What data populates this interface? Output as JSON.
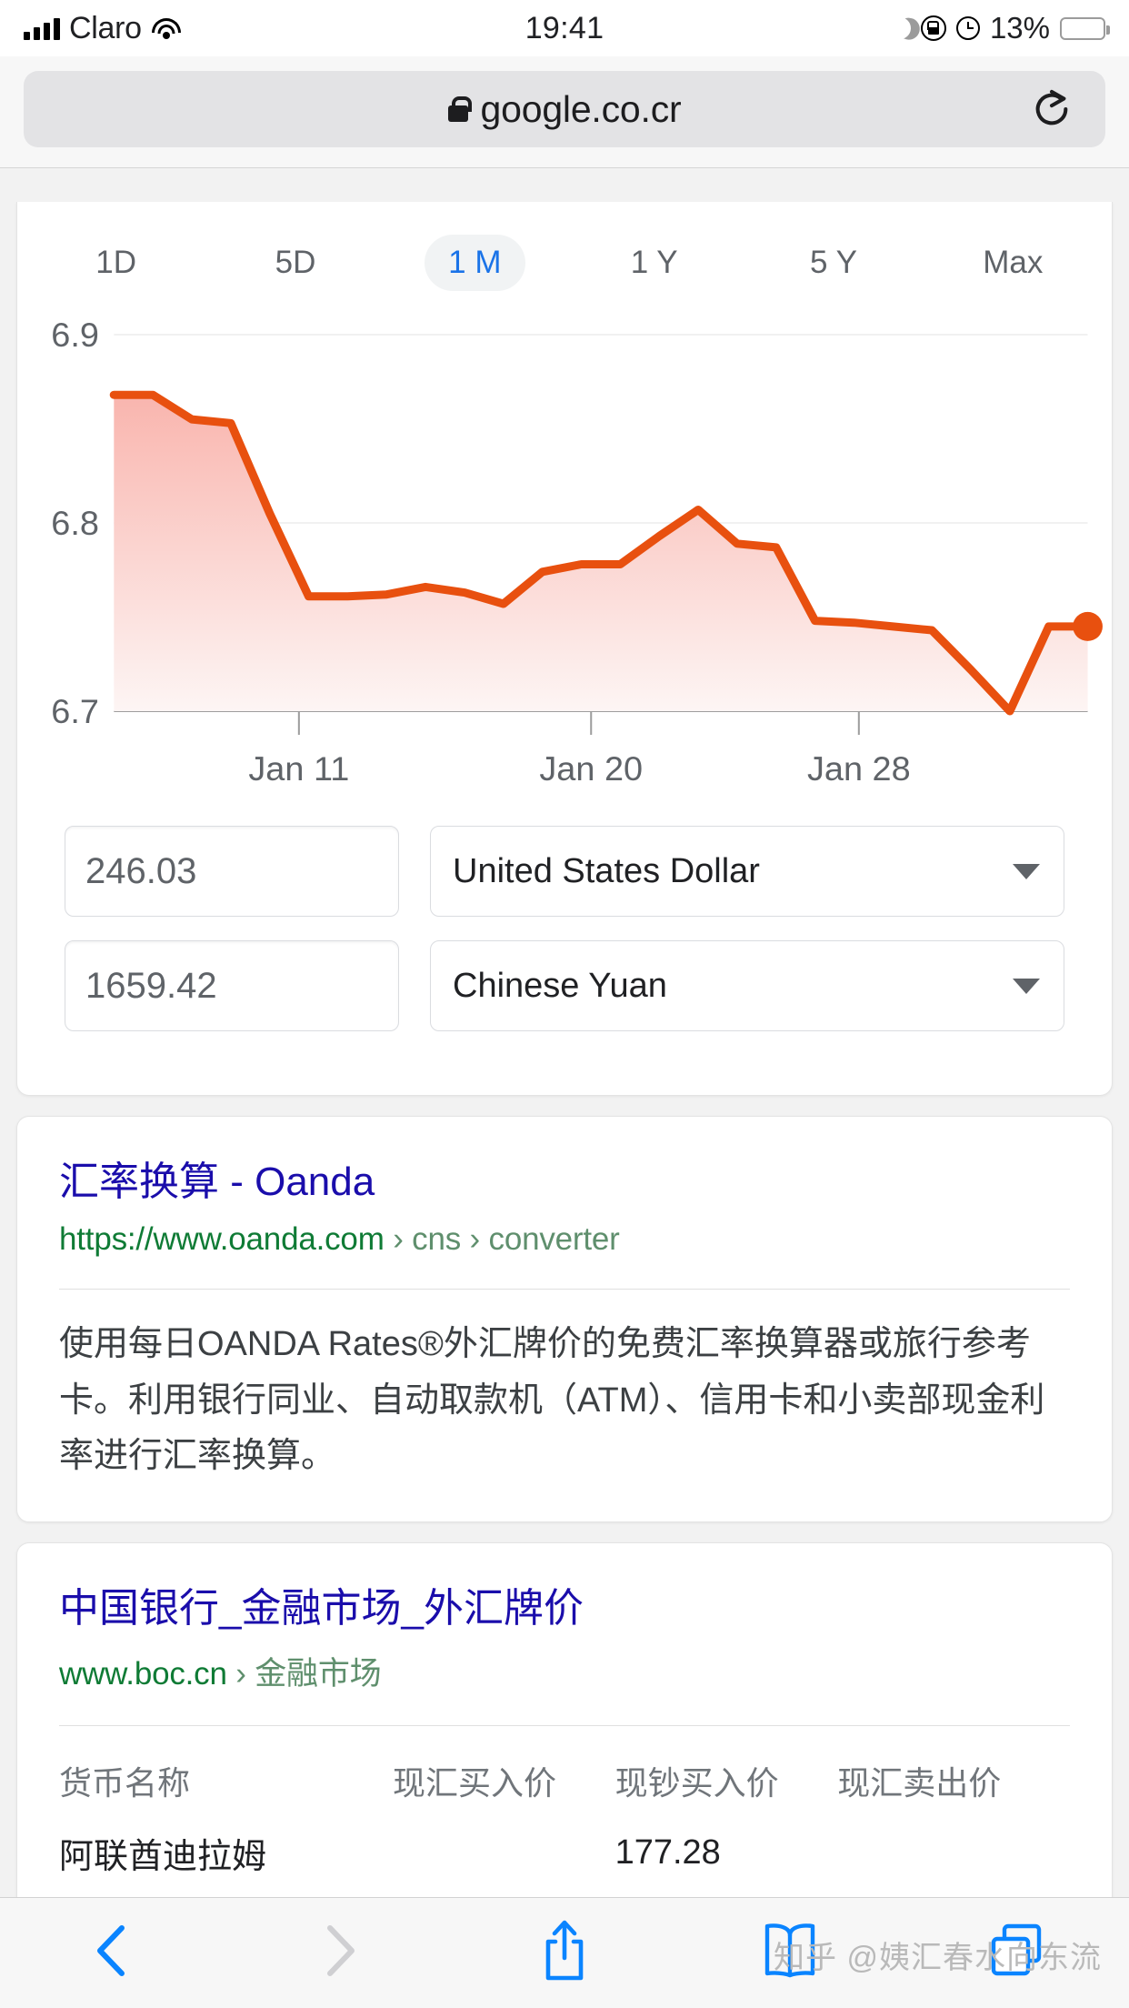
{
  "status_bar": {
    "carrier": "Claro",
    "time": "19:41",
    "battery_percent": "13%",
    "icons": [
      "signal-icon",
      "wifi-icon",
      "moon-icon",
      "rotation-lock-icon",
      "alarm-icon",
      "battery-icon"
    ]
  },
  "browser": {
    "url": "google.co.cr",
    "lock_icon": "lock-icon",
    "reload_icon": "reload-icon"
  },
  "chart_card": {
    "ranges": [
      {
        "label": "1D",
        "active": false
      },
      {
        "label": "5D",
        "active": false
      },
      {
        "label": "1 M",
        "active": true
      },
      {
        "label": "1 Y",
        "active": false
      },
      {
        "label": "5 Y",
        "active": false
      },
      {
        "label": "Max",
        "active": false
      }
    ]
  },
  "chart_data": {
    "type": "area",
    "title": "",
    "xlabel": "",
    "ylabel": "",
    "ylim": [
      6.7,
      6.9
    ],
    "yticks": [
      "6.9",
      "6.8",
      "6.7"
    ],
    "xticks": [
      "Jan 11",
      "Jan 20",
      "Jan 28"
    ],
    "xtick_positions": [
      0.19,
      0.49,
      0.765
    ],
    "grid": true,
    "line_color": "#e8500f",
    "fill_top_color": "#f9b5ae",
    "fill_bottom_color": "#fdf5f4",
    "end_marker": true,
    "series": [
      {
        "name": "USD/CNY",
        "values": [
          6.868,
          6.868,
          6.855,
          6.853,
          6.805,
          6.761,
          6.761,
          6.762,
          6.766,
          6.763,
          6.757,
          6.774,
          6.778,
          6.778,
          6.793,
          6.807,
          6.789,
          6.787,
          6.748,
          6.747,
          6.745,
          6.743,
          6.722,
          6.7,
          6.745,
          6.745
        ]
      }
    ]
  },
  "converter": {
    "amount_from": "246.03",
    "currency_from": "United States Dollar",
    "amount_to": "1659.42",
    "currency_to": "Chinese Yuan",
    "caret_icon": "chevron-down-icon"
  },
  "results": [
    {
      "title": "汇率换算 - Oanda",
      "url": "https://www.oanda.com",
      "breadcrumb": "› cns › converter",
      "snippet": "使用每日OANDA Rates®外汇牌价的免费汇率换算器或旅行参考卡。利用银行同业、自动取款机（ATM）、信用卡和小卖部现金利率进行汇率换算。"
    },
    {
      "title": "中国银行_金融市场_外汇牌价",
      "url": "www.boc.cn",
      "breadcrumb": "› 金融市场",
      "table": {
        "headers": [
          "货币名称",
          "现汇买入价",
          "现钞买入价",
          "现汇卖出价"
        ],
        "rows": [
          [
            "阿联酋迪拉姆",
            "",
            "177.28",
            ""
          ]
        ]
      }
    }
  ],
  "toolbar": {
    "back_icon": "back-chevron-icon",
    "forward_icon": "forward-chevron-icon",
    "share_icon": "share-icon",
    "bookmarks_icon": "book-icon",
    "tabs_icon": "tabs-icon"
  },
  "watermark": "知乎 @姨汇春水向东流"
}
